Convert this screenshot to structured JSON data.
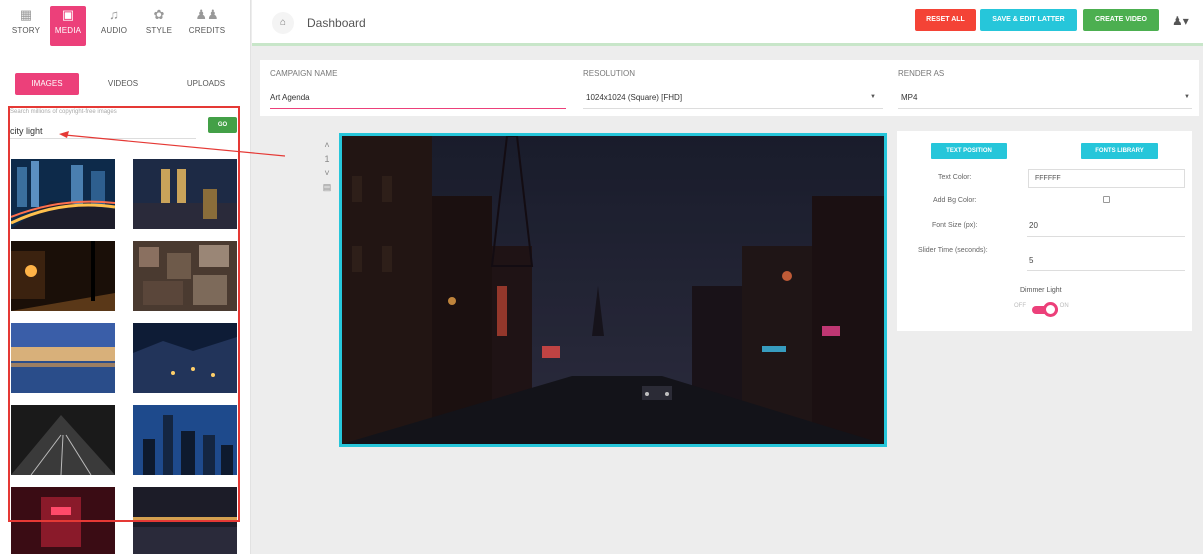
{
  "sidebar": {
    "tabs": [
      {
        "label": "STORY",
        "icon": "document-icon"
      },
      {
        "label": "MEDIA",
        "icon": "images-icon"
      },
      {
        "label": "AUDIO",
        "icon": "music-note-icon"
      },
      {
        "label": "STYLE",
        "icon": "palette-icon"
      },
      {
        "label": "CREDITS",
        "icon": "people-icon"
      }
    ],
    "active_tab": "MEDIA",
    "media_tabs": [
      "IMAGES",
      "VIDEOS",
      "UPLOADS"
    ],
    "active_media_tab": "IMAGES",
    "search": {
      "hint": "Search millions of copyright-free images",
      "value": "city light",
      "go_label": "GO"
    }
  },
  "header": {
    "title": "Dashboard",
    "buttons": [
      {
        "label": "RESET ALL",
        "color": "#f44336"
      },
      {
        "label": "SAVE & EDIT LATTER",
        "color": "#26c6da"
      },
      {
        "label": "CREATE VIDEO",
        "color": "#4caf50"
      }
    ]
  },
  "form": {
    "campaign_label": "CAMPAIGN NAME",
    "campaign_value": "Art Agenda",
    "resolution_label": "RESOLUTION",
    "resolution_value": "1024x1024 (Square) [FHD]",
    "render_label": "RENDER AS",
    "render_value": "MP4"
  },
  "slide": {
    "number": "1"
  },
  "settings": {
    "text_position_label": "TEXT POSITION",
    "fonts_library_label": "FONTS LIBRARY",
    "text_color_label": "Text Color:",
    "text_color_value": "FFFFFF",
    "add_bg_label": "Add Bg Color:",
    "font_size_label": "Font Size (px):",
    "font_size_value": "20",
    "slider_time_label": "Slider Time (seconds):",
    "slider_time_value": "5",
    "dimmer_label": "Dimmer Light",
    "toggle_off": "OFF",
    "toggle_on": "ON"
  },
  "colors": {
    "accent": "#ec407a",
    "cyan": "#26c6da",
    "highlight_box": "#e53935"
  }
}
